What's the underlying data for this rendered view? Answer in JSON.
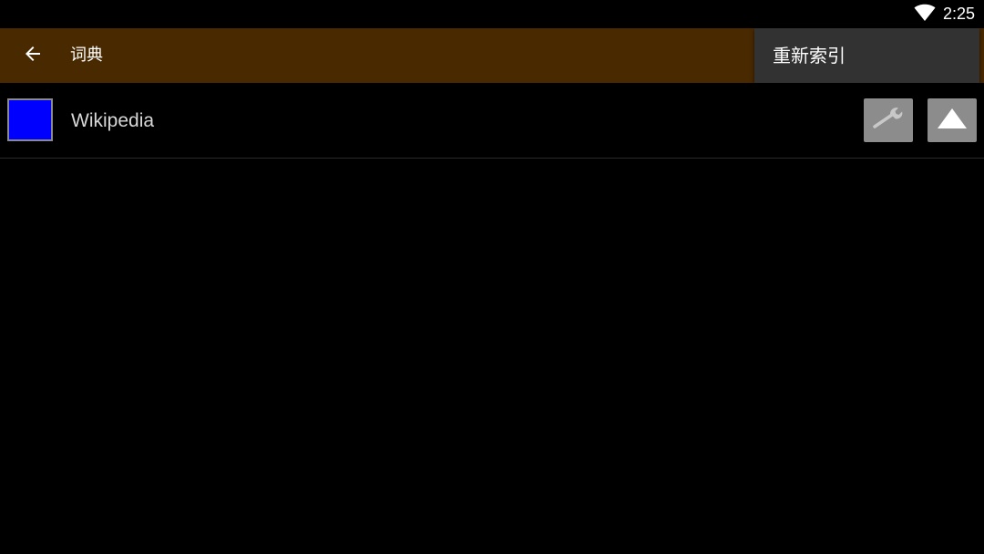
{
  "status_bar": {
    "time": "2:25",
    "wifi_icon": "wifi-icon"
  },
  "app_bar": {
    "back_icon": "arrow-back-icon",
    "title": "词典",
    "background_color": "#492900"
  },
  "overflow_menu": {
    "items": [
      {
        "label": "重新索引"
      }
    ]
  },
  "dictionaries": [
    {
      "name": "Wikipedia",
      "color": "#0000ff",
      "settings_icon": "wrench-icon",
      "move_icon": "triangle-up-icon"
    }
  ]
}
